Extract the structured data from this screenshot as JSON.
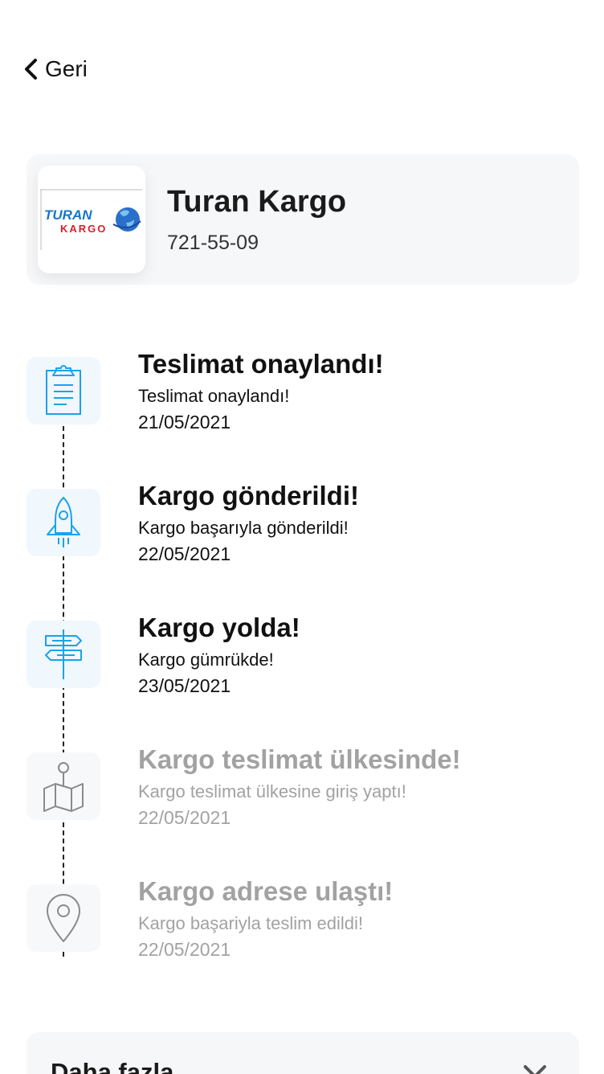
{
  "nav": {
    "back_label": "Geri"
  },
  "carrier": {
    "name": "Turan Kargo",
    "phone": "721-55-09",
    "logo_text_top": "TURAN",
    "logo_text_bottom": "KARGO"
  },
  "steps": [
    {
      "title": "Teslimat onaylandı!",
      "description": "Teslimat onaylandı!",
      "date": "21/05/2021",
      "icon": "clipboard-icon",
      "active": true
    },
    {
      "title": "Kargo gönderildi!",
      "description": "Kargo başarıyla gönderildi!",
      "date": "22/05/2021",
      "icon": "rocket-icon",
      "active": true
    },
    {
      "title": "Kargo yolda!",
      "description": "Kargo gümrükde!",
      "date": "23/05/2021",
      "icon": "signpost-icon",
      "active": true
    },
    {
      "title": "Kargo teslimat ülkesinde!",
      "description": "Kargo teslimat ülkesine giriş yaptı!",
      "date": "22/05/2021",
      "icon": "map-pin-icon",
      "active": false
    },
    {
      "title": "Kargo adrese ulaştı!",
      "description": "Kargo başariyla teslim edildi!",
      "date": "22/05/2021",
      "icon": "location-icon",
      "active": false
    }
  ],
  "more": {
    "label": "Daha fazla"
  },
  "colors": {
    "accent": "#1aa3e8",
    "inactive_icon": "#8a8a8a",
    "inactive_text": "#a2a2a2"
  }
}
